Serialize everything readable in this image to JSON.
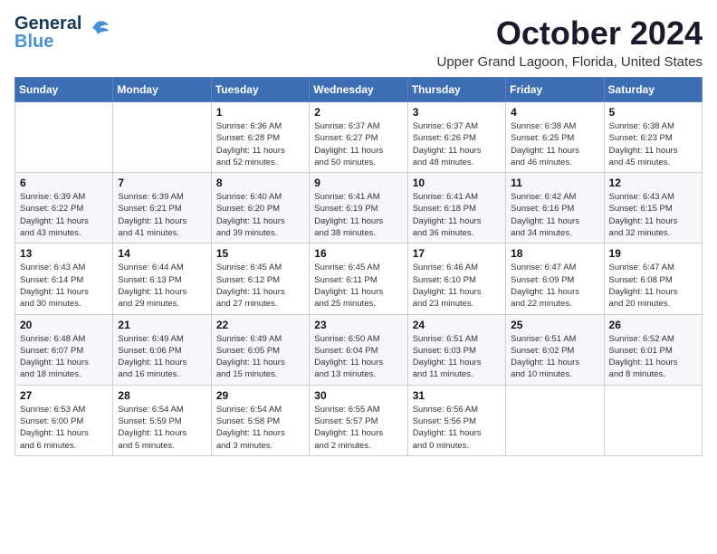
{
  "logo": {
    "line1": "General",
    "line2": "Blue"
  },
  "title": "October 2024",
  "location": "Upper Grand Lagoon, Florida, United States",
  "days_of_week": [
    "Sunday",
    "Monday",
    "Tuesday",
    "Wednesday",
    "Thursday",
    "Friday",
    "Saturday"
  ],
  "weeks": [
    [
      {
        "day": "",
        "detail": ""
      },
      {
        "day": "",
        "detail": ""
      },
      {
        "day": "1",
        "detail": "Sunrise: 6:36 AM\nSunset: 6:28 PM\nDaylight: 11 hours\nand 52 minutes."
      },
      {
        "day": "2",
        "detail": "Sunrise: 6:37 AM\nSunset: 6:27 PM\nDaylight: 11 hours\nand 50 minutes."
      },
      {
        "day": "3",
        "detail": "Sunrise: 6:37 AM\nSunset: 6:26 PM\nDaylight: 11 hours\nand 48 minutes."
      },
      {
        "day": "4",
        "detail": "Sunrise: 6:38 AM\nSunset: 6:25 PM\nDaylight: 11 hours\nand 46 minutes."
      },
      {
        "day": "5",
        "detail": "Sunrise: 6:38 AM\nSunset: 6:23 PM\nDaylight: 11 hours\nand 45 minutes."
      }
    ],
    [
      {
        "day": "6",
        "detail": "Sunrise: 6:39 AM\nSunset: 6:22 PM\nDaylight: 11 hours\nand 43 minutes."
      },
      {
        "day": "7",
        "detail": "Sunrise: 6:39 AM\nSunset: 6:21 PM\nDaylight: 11 hours\nand 41 minutes."
      },
      {
        "day": "8",
        "detail": "Sunrise: 6:40 AM\nSunset: 6:20 PM\nDaylight: 11 hours\nand 39 minutes."
      },
      {
        "day": "9",
        "detail": "Sunrise: 6:41 AM\nSunset: 6:19 PM\nDaylight: 11 hours\nand 38 minutes."
      },
      {
        "day": "10",
        "detail": "Sunrise: 6:41 AM\nSunset: 6:18 PM\nDaylight: 11 hours\nand 36 minutes."
      },
      {
        "day": "11",
        "detail": "Sunrise: 6:42 AM\nSunset: 6:16 PM\nDaylight: 11 hours\nand 34 minutes."
      },
      {
        "day": "12",
        "detail": "Sunrise: 6:43 AM\nSunset: 6:15 PM\nDaylight: 11 hours\nand 32 minutes."
      }
    ],
    [
      {
        "day": "13",
        "detail": "Sunrise: 6:43 AM\nSunset: 6:14 PM\nDaylight: 11 hours\nand 30 minutes."
      },
      {
        "day": "14",
        "detail": "Sunrise: 6:44 AM\nSunset: 6:13 PM\nDaylight: 11 hours\nand 29 minutes."
      },
      {
        "day": "15",
        "detail": "Sunrise: 6:45 AM\nSunset: 6:12 PM\nDaylight: 11 hours\nand 27 minutes."
      },
      {
        "day": "16",
        "detail": "Sunrise: 6:45 AM\nSunset: 6:11 PM\nDaylight: 11 hours\nand 25 minutes."
      },
      {
        "day": "17",
        "detail": "Sunrise: 6:46 AM\nSunset: 6:10 PM\nDaylight: 11 hours\nand 23 minutes."
      },
      {
        "day": "18",
        "detail": "Sunrise: 6:47 AM\nSunset: 6:09 PM\nDaylight: 11 hours\nand 22 minutes."
      },
      {
        "day": "19",
        "detail": "Sunrise: 6:47 AM\nSunset: 6:08 PM\nDaylight: 11 hours\nand 20 minutes."
      }
    ],
    [
      {
        "day": "20",
        "detail": "Sunrise: 6:48 AM\nSunset: 6:07 PM\nDaylight: 11 hours\nand 18 minutes."
      },
      {
        "day": "21",
        "detail": "Sunrise: 6:49 AM\nSunset: 6:06 PM\nDaylight: 11 hours\nand 16 minutes."
      },
      {
        "day": "22",
        "detail": "Sunrise: 6:49 AM\nSunset: 6:05 PM\nDaylight: 11 hours\nand 15 minutes."
      },
      {
        "day": "23",
        "detail": "Sunrise: 6:50 AM\nSunset: 6:04 PM\nDaylight: 11 hours\nand 13 minutes."
      },
      {
        "day": "24",
        "detail": "Sunrise: 6:51 AM\nSunset: 6:03 PM\nDaylight: 11 hours\nand 11 minutes."
      },
      {
        "day": "25",
        "detail": "Sunrise: 6:51 AM\nSunset: 6:02 PM\nDaylight: 11 hours\nand 10 minutes."
      },
      {
        "day": "26",
        "detail": "Sunrise: 6:52 AM\nSunset: 6:01 PM\nDaylight: 11 hours\nand 8 minutes."
      }
    ],
    [
      {
        "day": "27",
        "detail": "Sunrise: 6:53 AM\nSunset: 6:00 PM\nDaylight: 11 hours\nand 6 minutes."
      },
      {
        "day": "28",
        "detail": "Sunrise: 6:54 AM\nSunset: 5:59 PM\nDaylight: 11 hours\nand 5 minutes."
      },
      {
        "day": "29",
        "detail": "Sunrise: 6:54 AM\nSunset: 5:58 PM\nDaylight: 11 hours\nand 3 minutes."
      },
      {
        "day": "30",
        "detail": "Sunrise: 6:55 AM\nSunset: 5:57 PM\nDaylight: 11 hours\nand 2 minutes."
      },
      {
        "day": "31",
        "detail": "Sunrise: 6:56 AM\nSunset: 5:56 PM\nDaylight: 11 hours\nand 0 minutes."
      },
      {
        "day": "",
        "detail": ""
      },
      {
        "day": "",
        "detail": ""
      }
    ]
  ]
}
